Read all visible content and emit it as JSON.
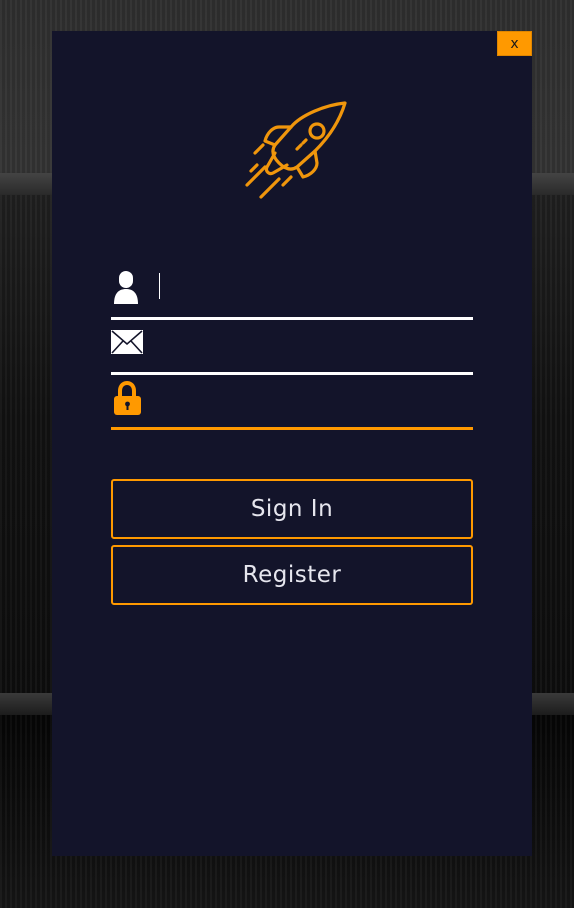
{
  "modal": {
    "close_label": "x",
    "logo_icon": "rocket-icon"
  },
  "form": {
    "username": {
      "icon": "user-icon",
      "value": "",
      "placeholder": ""
    },
    "email": {
      "icon": "envelope-icon",
      "value": "",
      "placeholder": ""
    },
    "password": {
      "icon": "lock-icon",
      "value": "",
      "placeholder": ""
    }
  },
  "buttons": {
    "sign_in_label": "Sign In",
    "register_label": "Register"
  },
  "colors": {
    "accent": "#ff9900",
    "modal_background": "#13142a",
    "field_underline": "#ffffff",
    "text": "#e6e6ee"
  }
}
